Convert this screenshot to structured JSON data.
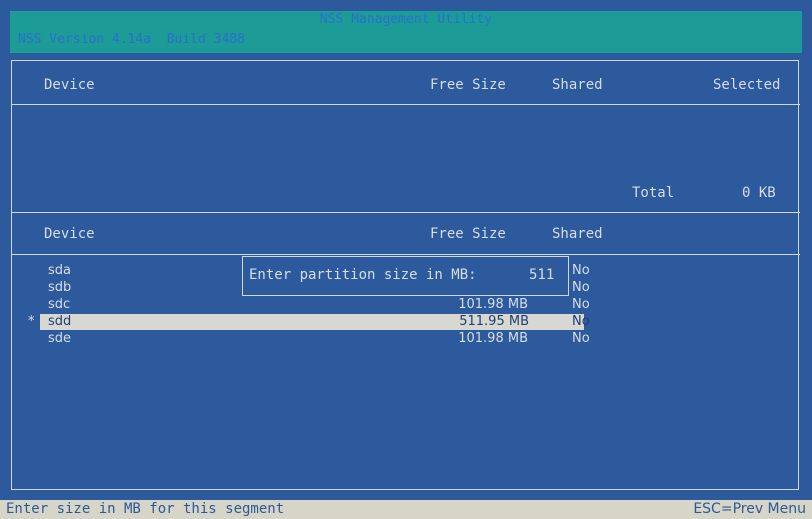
{
  "title": {
    "app_name": "NSS Management Utility",
    "version": "NSS Version 4.14a  Build 3488"
  },
  "selected_pane": {
    "col_device": "Device",
    "col_free_size": "Free Size",
    "col_shared": "Shared",
    "col_selected": "Selected",
    "total_label": "Total",
    "total_value": "0 KB"
  },
  "device_pane": {
    "col_device": "Device",
    "col_free_size": "Free Size",
    "col_shared": "Shared",
    "rows": [
      {
        "marker": "",
        "device": "sda",
        "free_size": "",
        "shared": "No"
      },
      {
        "marker": "",
        "device": "sdb",
        "free_size": "",
        "shared": "No"
      },
      {
        "marker": "",
        "device": "sdc",
        "free_size": "101.98 MB",
        "shared": "No"
      },
      {
        "marker": "*",
        "device": "sdd",
        "free_size": "511.95 MB",
        "shared": "No"
      },
      {
        "marker": "",
        "device": "sde",
        "free_size": "101.98 MB",
        "shared": "No"
      }
    ]
  },
  "dialog": {
    "prompt": "Enter partition size in MB: ",
    "value": "511"
  },
  "status": {
    "hint": "Enter size in MB for this segment",
    "esc": "ESC=Prev Menu"
  },
  "colors": {
    "background": "#2d5a9c",
    "title_bar": "#1c9b97",
    "selection": "#d8d8d2",
    "status_bar": "#d7d4c8"
  }
}
